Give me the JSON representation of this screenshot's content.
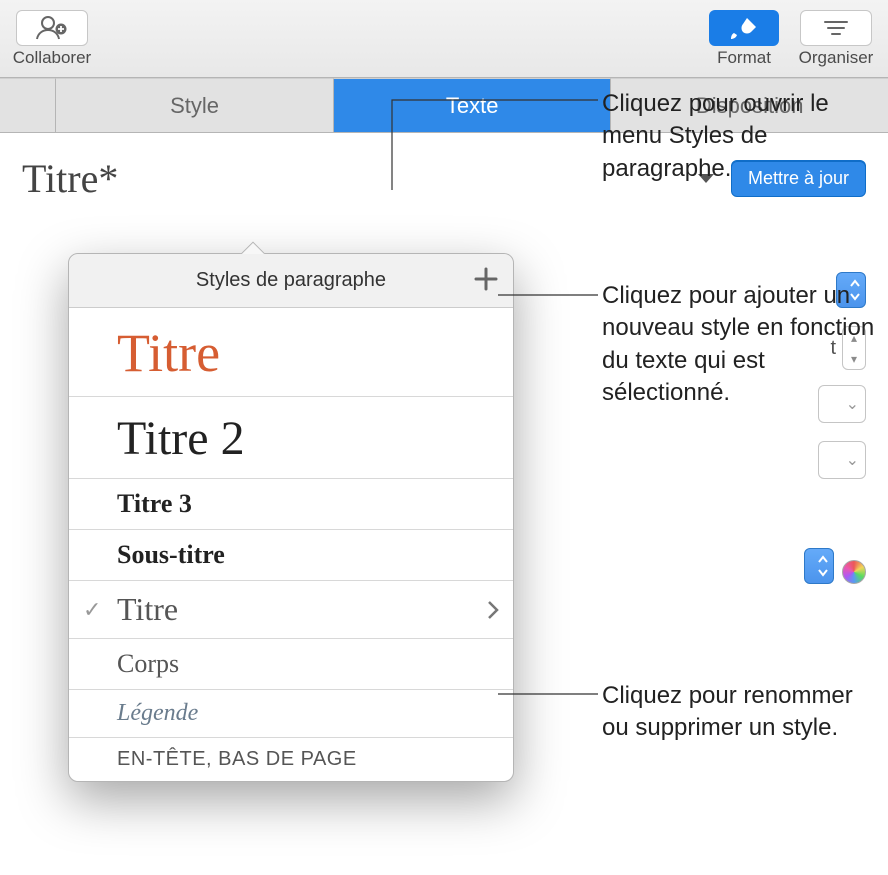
{
  "toolbar": {
    "collaborate_label": "Collaborer",
    "format_label": "Format",
    "organize_label": "Organiser"
  },
  "tabs": {
    "style": "Style",
    "text": "Texte",
    "layout": "Disposition"
  },
  "style_row": {
    "current": "Titre*",
    "update_label": "Mettre à jour"
  },
  "obscured": {
    "stepper_suffix": "t"
  },
  "popover": {
    "title": "Styles de paragraphe",
    "items": [
      {
        "label": "Titre",
        "css": "font-size:54px;color:#d65d32;font-weight:400;"
      },
      {
        "label": "Titre 2",
        "css": "font-size:48px;color:#222;"
      },
      {
        "label": "Titre 3",
        "css": "font-size:26px;color:#222;font-weight:700;"
      },
      {
        "label": "Sous-titre",
        "css": "font-size:26px;color:#222;font-weight:700;"
      },
      {
        "label": "Titre",
        "css": "font-size:32px;color:#555;",
        "checked": true,
        "arrow": true
      },
      {
        "label": "Corps",
        "css": "font-size:26px;color:#555;"
      },
      {
        "label": "Légende",
        "css": "font-size:24px;font-style:italic;color:#6a7c8d;"
      },
      {
        "label": "EN-TÊTE, BAS DE PAGE",
        "css": "font-size:20px;font-family:-apple-system,Arial;color:#555;letter-spacing:.5px;"
      }
    ]
  },
  "callouts": {
    "open_menu": "Cliquez pour ouvrir le menu Styles de paragraphe.",
    "add_style": "Cliquez pour ajouter un nouveau style en fonction du texte qui est sélectionné.",
    "rename_delete": "Cliquez pour renommer ou supprimer un style."
  }
}
